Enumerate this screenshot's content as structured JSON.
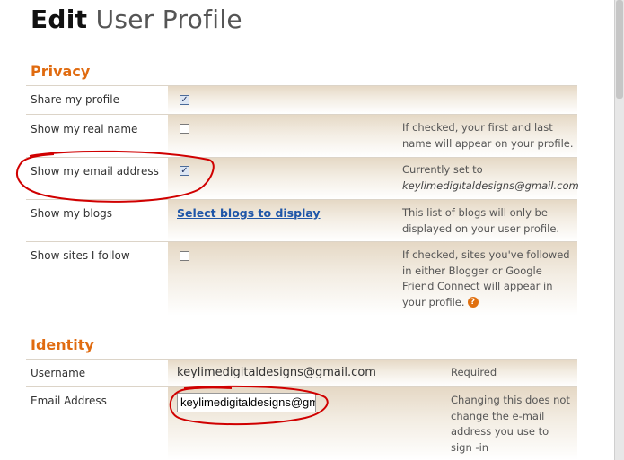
{
  "page": {
    "title_bold": "Edit",
    "title_rest": "User Profile"
  },
  "privacy": {
    "heading": "Privacy",
    "rows": [
      {
        "label": "Share my profile",
        "checked": true,
        "help": ""
      },
      {
        "label": "Show my real name",
        "checked": false,
        "help": "If checked, your first and last name will appear on your profile."
      },
      {
        "label": "Show my email address",
        "checked": true,
        "help": "Currently set to",
        "help_email": "keylimedigitaldesigns@gmail.com"
      },
      {
        "label": "Show my blogs",
        "link": "Select blogs to display",
        "help": "This list of blogs will only be displayed on your user profile."
      },
      {
        "label": "Show sites I follow",
        "checked": false,
        "help": "If checked, sites you've followed in either Blogger or Google Friend Connect will appear in your profile."
      }
    ]
  },
  "identity": {
    "heading": "Identity",
    "username": {
      "label": "Username",
      "value": "keylimedigitaldesigns@gmail.com",
      "note": "Required"
    },
    "email": {
      "label": "Email Address",
      "value": "keylimedigitaldesigns@gmail.com",
      "help": "Changing this does not change the e-mail address you use to sign -in"
    }
  },
  "icons": {
    "check": "checkmark-icon",
    "help": "question-mark-icon"
  },
  "colors": {
    "accent": "#e06b10",
    "link": "#1f56a8",
    "annotation": "#d00000"
  }
}
